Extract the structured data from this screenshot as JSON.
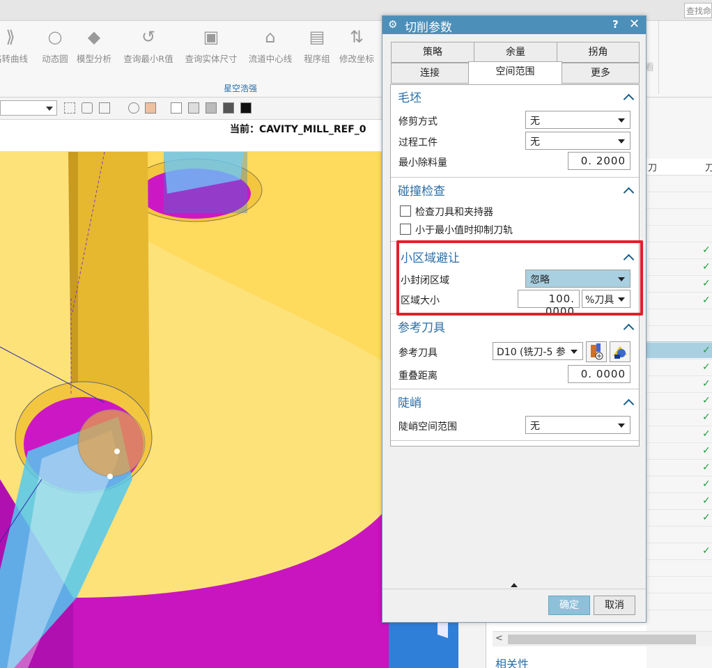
{
  "app": {
    "search_placeholder": "查找命",
    "ribbon_tools": [
      "路转曲线",
      "动态圆",
      "模型分析",
      "查询最小R值",
      "查询实体尺寸",
      "流道中心线",
      "程序组",
      "修改坐标"
    ],
    "ribbon_group": "星空浩强",
    "ribbon_right_label": "看",
    "current_program": "当前：CAVITY_MILL_REF_0",
    "navigator_col1": "刀",
    "navigator_col2": "刀",
    "related": "相关性",
    "scroll_left": "<"
  },
  "dialog": {
    "title": "切削参数",
    "help": "?",
    "close": "✕",
    "tabs_row1": [
      "策略",
      "余量",
      "拐角"
    ],
    "tabs_row2": [
      "连接",
      "空间范围",
      "更多"
    ],
    "active_tab": "空间范围",
    "blank": {
      "title": "毛坯",
      "trim_label": "修剪方式",
      "trim_value": "无",
      "ipw_label": "过程工件",
      "ipw_value": "无",
      "min_removal_label": "最小除料量",
      "min_removal_value": "0. 2000"
    },
    "collision": {
      "title": "碰撞检查",
      "check_holder_label": "检查刀具和夹持器",
      "suppress_label": "小于最小值时抑制刀轨"
    },
    "small_area": {
      "title": "小区域避让",
      "closed_label": "小封闭区域",
      "closed_value": "忽略",
      "size_label": "区域大小",
      "size_value": "100. 0000",
      "size_unit": "%刀具"
    },
    "ref_tool": {
      "title": "参考刀具",
      "tool_label": "参考刀具",
      "tool_value": "D10 (铣刀-5 参",
      "overlap_label": "重叠距离",
      "overlap_value": "0. 0000"
    },
    "steep": {
      "title": "陡峭",
      "range_label": "陡峭空间范围",
      "range_value": "无"
    },
    "ok": "确定",
    "cancel": "取消"
  }
}
